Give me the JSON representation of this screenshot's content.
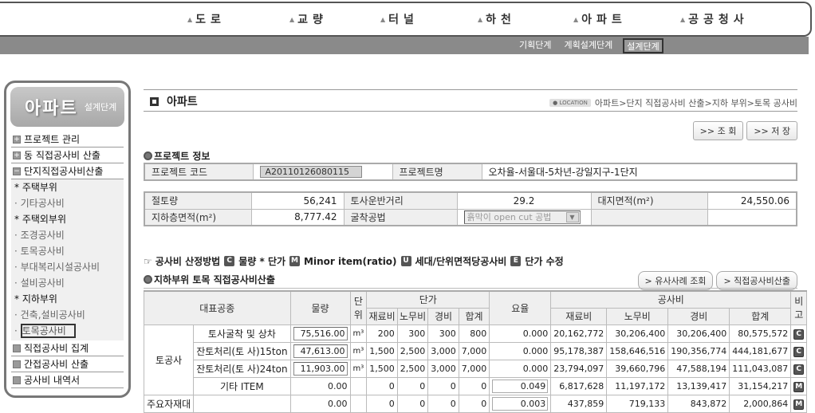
{
  "topnav": {
    "items": [
      {
        "label": "도로"
      },
      {
        "label": "교량"
      },
      {
        "label": "터널"
      },
      {
        "label": "하천"
      },
      {
        "label": "아파트"
      },
      {
        "label": "공공청사"
      }
    ],
    "stages": [
      {
        "label": "기획단계",
        "active": false
      },
      {
        "label": "계획설계단계",
        "active": false
      },
      {
        "label": "설계단계",
        "active": true
      }
    ]
  },
  "sidebar": {
    "title": "아파트",
    "subtitle": "설계단계",
    "groups": [
      {
        "label": "프로젝트 관리",
        "icon": "plus"
      },
      {
        "label": "동 직접공사비 산출",
        "icon": "plus"
      },
      {
        "label": "단지직접공사비산출",
        "icon": "minus"
      }
    ],
    "sub": [
      {
        "type": "cat",
        "label": "* 주택부위"
      },
      {
        "type": "leaf",
        "label": "기타공사비"
      },
      {
        "type": "cat",
        "label": "* 주택외부위"
      },
      {
        "type": "leaf",
        "label": "조경공사비"
      },
      {
        "type": "leaf",
        "label": "토목공사비"
      },
      {
        "type": "leaf",
        "label": "부대복리시설공사비"
      },
      {
        "type": "leaf",
        "label": "설비공사비"
      },
      {
        "type": "cat",
        "label": "* 지하부위"
      },
      {
        "type": "leaf",
        "label": "건축,설비공사비"
      },
      {
        "type": "leaf",
        "label": "토목공사비",
        "active": true
      }
    ],
    "groups_after": [
      {
        "label": "직접공사비 집계"
      },
      {
        "label": "간접공사비 산출"
      },
      {
        "label": "공사비 내역서"
      }
    ]
  },
  "page": {
    "title": "아파트",
    "location_badge": "LOCATION",
    "breadcrumb": "아파트>단지 직접공사비 산출>지하 부위>토목 공사비",
    "btn_search": ">> 조 회",
    "btn_save": ">> 저 장"
  },
  "project_info": {
    "section_title": "프로젝트 정보",
    "code_label": "프로젝트 코드",
    "code_value": "A20110126080115",
    "name_label": "프로젝트명",
    "name_value": "오차율-서울대-5차년-강일지구-1단지"
  },
  "site_info": {
    "cut_label": "절토량",
    "cut_value": "56,241",
    "haul_label": "토사운반거리",
    "haul_value": "29.2",
    "site_area_label": "대지면적(m²)",
    "site_area_value": "24,550.06",
    "basement_label": "지하층면적(m²)",
    "basement_value": "8,777.42",
    "method_label": "굴착공법",
    "method_value": "흙막이 open cut 공법"
  },
  "legend": {
    "prefix": "공사비 산정방법",
    "items": [
      {
        "icon": "C",
        "label": "물량 * 단가"
      },
      {
        "icon": "M",
        "label": "Minor item(ratio)"
      },
      {
        "icon": "U",
        "label": "세대/단위면적당공사비"
      },
      {
        "icon": "E",
        "label": "단가 수정"
      }
    ]
  },
  "calc": {
    "section_title": "지하부위 토목 직접공사비산출",
    "btn_similar": "> 유사사례 조회",
    "btn_calc": "> 직접공사비산출",
    "headers": {
      "work_type": "대표공종",
      "qty": "물량",
      "unit": "단위",
      "unit_price": "단가",
      "rate": "요율",
      "cost": "공사비",
      "note": "비고",
      "material": "재료비",
      "labor": "노무비",
      "expense": "경비",
      "total": "합계"
    },
    "rows": [
      {
        "group": "토공사",
        "item": "토사굴착 및 상차",
        "qty": "75,516.00",
        "qty_input": true,
        "unit": "m³",
        "p_mat": "200",
        "p_lab": "300",
        "p_exp": "300",
        "p_tot": "800",
        "rate": "0.000",
        "rate_input": false,
        "c_mat": "20,162,772",
        "c_lab": "30,206,400",
        "c_exp": "30,206,400",
        "c_tot": "80,575,572",
        "tag": "C"
      },
      {
        "group": "",
        "item": "잔토처리(토 사)15ton",
        "qty": "47,613.00",
        "qty_input": true,
        "unit": "m³",
        "p_mat": "1,500",
        "p_lab": "2,500",
        "p_exp": "3,000",
        "p_tot": "7,000",
        "rate": "0.000",
        "rate_input": false,
        "c_mat": "95,178,387",
        "c_lab": "158,646,516",
        "c_exp": "190,356,774",
        "c_tot": "444,181,677",
        "tag": "C"
      },
      {
        "group": "",
        "item": "잔토처리(토 사)24ton",
        "qty": "11,903.00",
        "qty_input": true,
        "unit": "m³",
        "p_mat": "1,500",
        "p_lab": "2,500",
        "p_exp": "3,000",
        "p_tot": "7,000",
        "rate": "0.000",
        "rate_input": false,
        "c_mat": "23,794,097",
        "c_lab": "39,660,796",
        "c_exp": "47,588,194",
        "c_tot": "111,043,087",
        "tag": "C"
      },
      {
        "group": "",
        "item": "기타 ITEM",
        "qty": "0.00",
        "qty_input": false,
        "unit": "",
        "p_mat": "0",
        "p_lab": "0",
        "p_exp": "0",
        "p_tot": "0",
        "rate": "0.049",
        "rate_input": true,
        "c_mat": "6,817,628",
        "c_lab": "11,197,172",
        "c_exp": "13,139,417",
        "c_tot": "31,154,217",
        "tag": "M"
      },
      {
        "group": "주요자재대",
        "item": "",
        "qty": "0.00",
        "qty_input": false,
        "unit": "",
        "p_mat": "0",
        "p_lab": "0",
        "p_exp": "0",
        "p_tot": "0",
        "rate": "0.003",
        "rate_input": true,
        "c_mat": "437,859",
        "c_lab": "719,133",
        "c_exp": "843,872",
        "c_tot": "2,000,864",
        "tag": "M"
      }
    ]
  }
}
